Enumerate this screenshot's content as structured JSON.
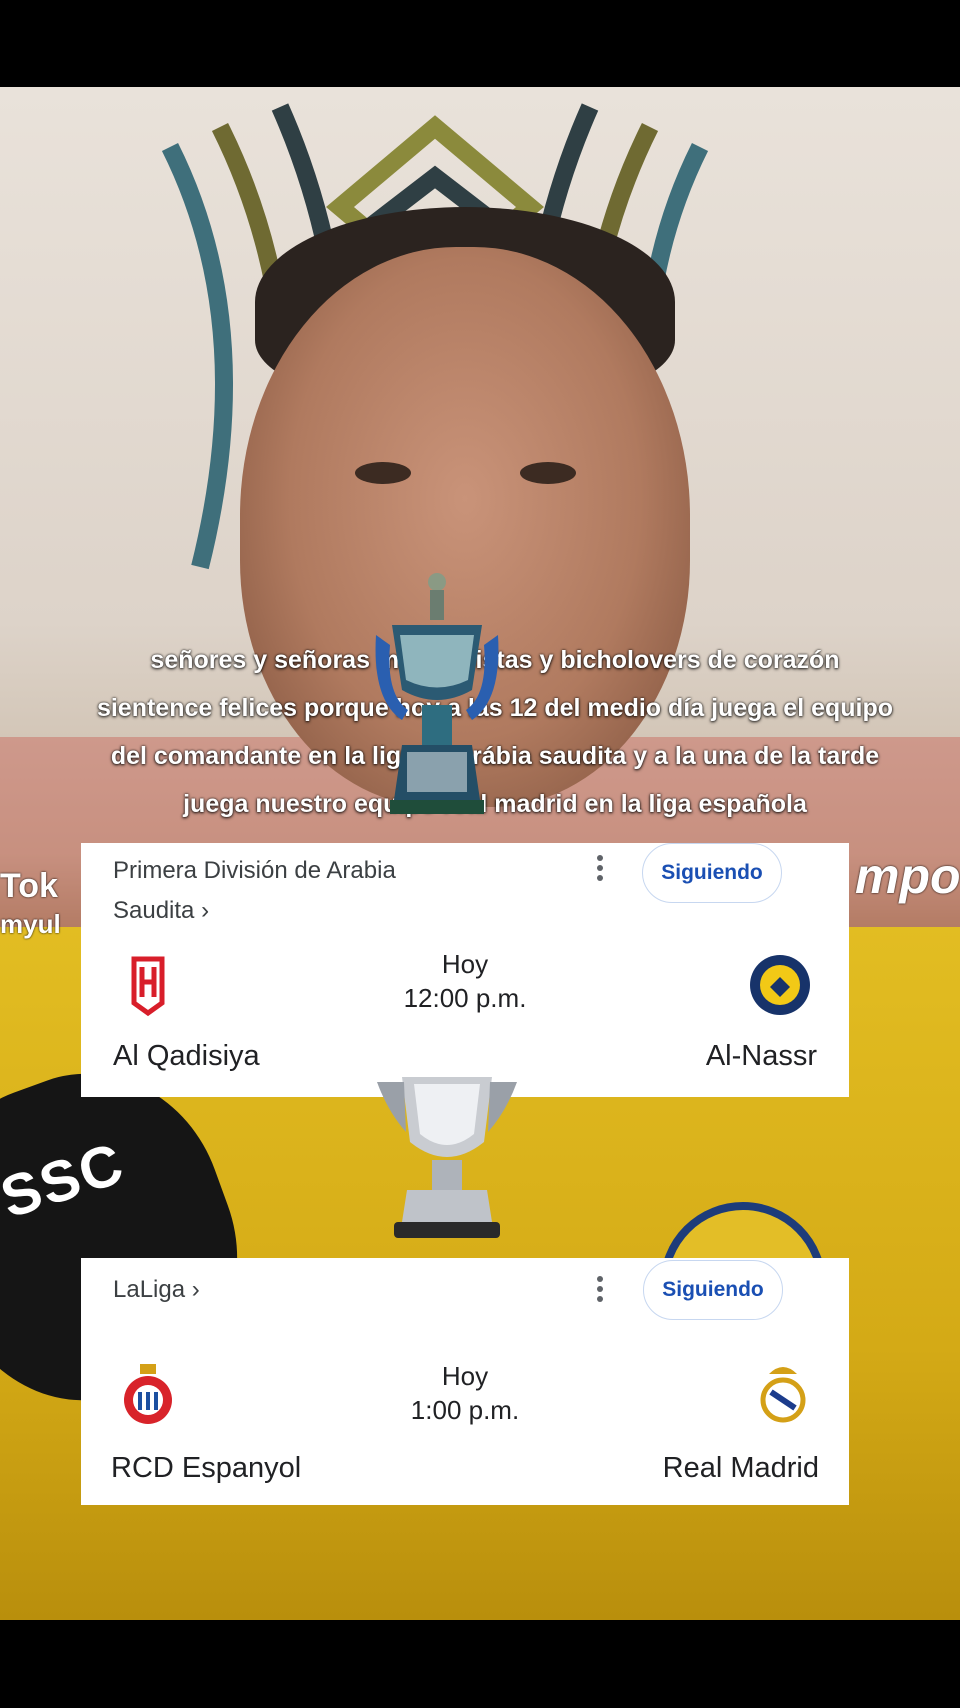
{
  "caption": {
    "lines": [
      "señores y señoras madrdidistas y bicholovers de corazón",
      "sientence felices porque hoy a las 12 del medio día juega el equipo",
      "del comandante en la liga de arábia saudita y a la una de la tarde",
      "juega nuestro equipo real madrid en la liga española"
    ]
  },
  "background": {
    "watermark_tok": "Tok",
    "watermark_user": "myul",
    "sponsor_fragment": "mpo",
    "mic_brand": "SSC"
  },
  "match1": {
    "league_line1": "Primera División de Arabia",
    "league_line2": "Saudita ›",
    "follow_label": "Siguiendo",
    "day": "Hoy",
    "time": "12:00 p.m.",
    "home_team": "Al Qadisiya",
    "away_team": "Al-Nassr"
  },
  "match2": {
    "league": "LaLiga ›",
    "follow_label": "Siguiendo",
    "day": "Hoy",
    "time": "1:00 p.m.",
    "home_team": "RCD Espanyol",
    "away_team": "Real Madrid"
  },
  "colors": {
    "card_bg": "#ffffff",
    "follow_text": "#1a4fb3",
    "shirt_yellow": "#d8b01c",
    "nassr_blue": "#1d3c7a"
  }
}
